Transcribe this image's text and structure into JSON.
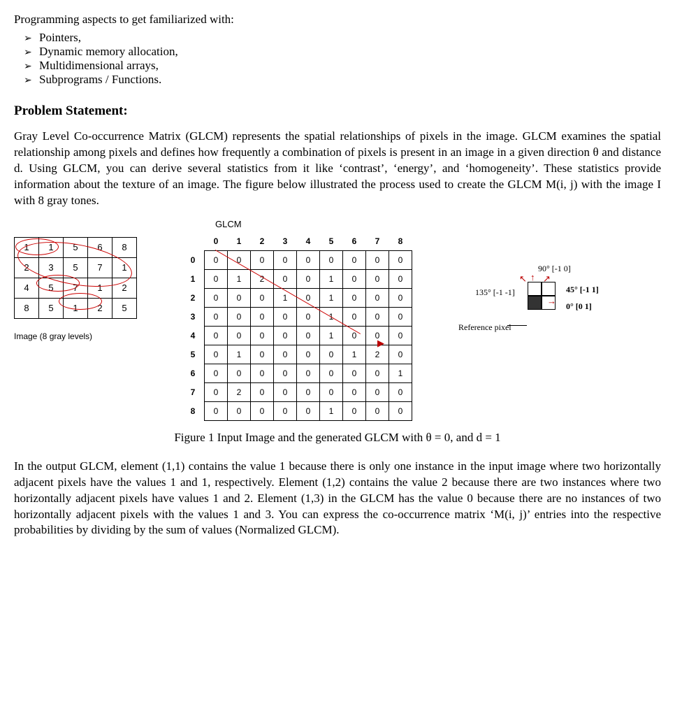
{
  "intro": "Programming aspects to get familiarized with:",
  "bullets": [
    "Pointers,",
    "Dynamic memory allocation,",
    "Multidimensional arrays,",
    "Subprograms / Functions."
  ],
  "section_heading": "Problem Statement:",
  "para1": "Gray Level Co-occurrence Matrix (GLCM) represents the spatial relationships of pixels in the image. GLCM examines the spatial relationship among pixels and defines how frequently a combination of pixels is present in an image in a given direction θ and distance d. Using GLCM, you can derive several statistics from it like ‘contrast’, ‘energy’, and ‘homogeneity’. These statistics provide information about the texture of an image. The figure below illustrated the process used to create the GLCM M(i, j) with the image I with 8 gray tones.",
  "figure": {
    "glcm_label": "GLCM",
    "col_headers": [
      "0",
      "1",
      "2",
      "3",
      "4",
      "5",
      "6",
      "7",
      "8"
    ],
    "row_headers": [
      "0",
      "1",
      "2",
      "3",
      "4",
      "5",
      "6",
      "7",
      "8"
    ],
    "image_caption": "Image (8 gray levels)",
    "caption": "Figure 1 Input Image and the generated GLCM with θ = 0, and d = 1",
    "direction": {
      "top": "90° [-1 0]",
      "left": "135° [-1 -1]",
      "right_top": "45° [-1 1]",
      "right_bottom": "0° [0 1]",
      "ref": "Reference pixel"
    }
  },
  "para2": "In the output GLCM, element (1,1) contains the value 1 because there is only one instance in the input image where two horizontally adjacent pixels have the values 1 and 1, respectively. Element (1,2) contains the value 2 because there are two instances where two horizontally adjacent pixels have values 1 and 2. Element (1,3) in the GLCM has the value 0 because there are no instances of two horizontally adjacent pixels with the values 1 and 3. You can express the co-occurrence matrix ‘M(i, j)’ entries into the respective probabilities by dividing by the sum of values (Normalized GLCM).",
  "chart_data": {
    "type": "table",
    "image_matrix": {
      "title": "Image (8 gray levels)",
      "rows": [
        [
          1,
          1,
          5,
          6,
          8
        ],
        [
          2,
          3,
          5,
          7,
          1
        ],
        [
          4,
          5,
          7,
          1,
          2
        ],
        [
          8,
          5,
          1,
          2,
          5
        ]
      ]
    },
    "glcm_matrix": {
      "title": "GLCM",
      "theta": 0,
      "d": 1,
      "col_labels": [
        0,
        1,
        2,
        3,
        4,
        5,
        6,
        7,
        8
      ],
      "row_labels": [
        0,
        1,
        2,
        3,
        4,
        5,
        6,
        7,
        8
      ],
      "values": [
        [
          0,
          0,
          0,
          0,
          0,
          0,
          0,
          0,
          0
        ],
        [
          0,
          1,
          2,
          0,
          0,
          1,
          0,
          0,
          0
        ],
        [
          0,
          0,
          0,
          1,
          0,
          1,
          0,
          0,
          0
        ],
        [
          0,
          0,
          0,
          0,
          0,
          1,
          0,
          0,
          0
        ],
        [
          0,
          0,
          0,
          0,
          0,
          1,
          0,
          0,
          0
        ],
        [
          0,
          1,
          0,
          0,
          0,
          0,
          1,
          2,
          0
        ],
        [
          0,
          0,
          0,
          0,
          0,
          0,
          0,
          0,
          1
        ],
        [
          0,
          2,
          0,
          0,
          0,
          0,
          0,
          0,
          0
        ],
        [
          0,
          0,
          0,
          0,
          0,
          1,
          0,
          0,
          0
        ]
      ]
    },
    "direction_vectors": [
      {
        "label": "90°",
        "vector": [
          -1,
          0
        ]
      },
      {
        "label": "135°",
        "vector": [
          -1,
          -1
        ]
      },
      {
        "label": "45°",
        "vector": [
          -1,
          1
        ]
      },
      {
        "label": "0°",
        "vector": [
          0,
          1
        ]
      }
    ]
  }
}
